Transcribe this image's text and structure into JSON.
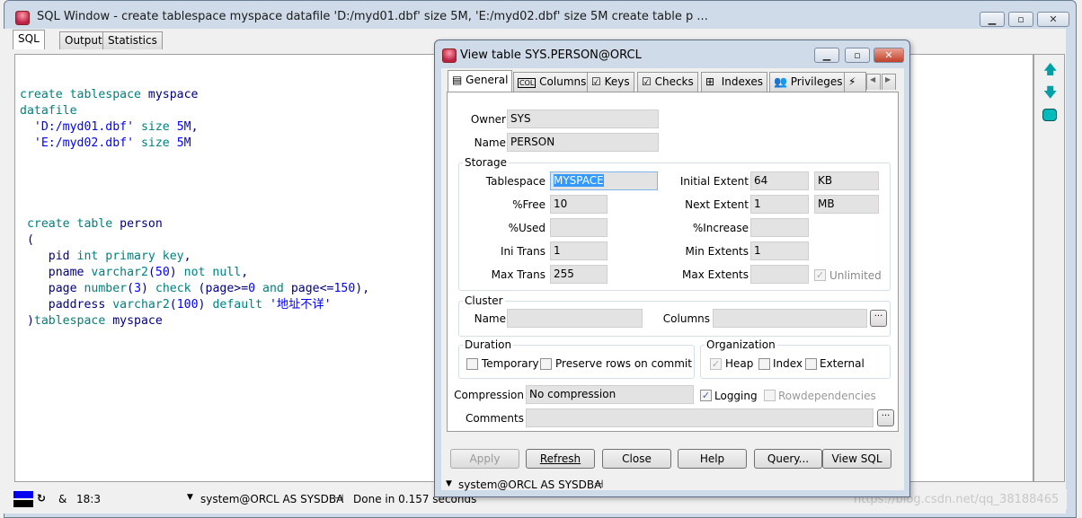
{
  "main_window": {
    "title": "SQL Window - create tablespace myspace datafile 'D:/myd01.dbf' size 5M, 'E:/myd02.dbf' size 5M create table p ...",
    "tabs": [
      {
        "label": "SQL",
        "active": true
      },
      {
        "label": "Output",
        "active": false
      },
      {
        "label": "Statistics",
        "active": false
      }
    ],
    "code_lines": [
      [],
      [],
      [
        [
          "kw",
          "create tablespace "
        ],
        [
          "id",
          "myspace"
        ]
      ],
      [
        [
          "kw",
          "datafile"
        ]
      ],
      [
        [
          "pl",
          "  "
        ],
        [
          "str",
          "'D:/myd01.dbf'"
        ],
        [
          "kw",
          " size "
        ],
        [
          "num",
          "5M"
        ],
        [
          "pl",
          ","
        ]
      ],
      [
        [
          "pl",
          "  "
        ],
        [
          "str",
          "'E:/myd02.dbf'"
        ],
        [
          "kw",
          " size "
        ],
        [
          "num",
          "5M"
        ]
      ],
      [],
      [],
      [],
      [],
      [
        [
          "pl",
          " "
        ],
        [
          "kw",
          "create table "
        ],
        [
          "id",
          "person"
        ]
      ],
      [
        [
          "pl",
          " ("
        ]
      ],
      [
        [
          "pl",
          "    "
        ],
        [
          "id",
          "pid"
        ],
        [
          "kw",
          " int primary key"
        ],
        [
          "pl",
          ","
        ]
      ],
      [
        [
          "pl",
          "    "
        ],
        [
          "id",
          "pname"
        ],
        [
          "kw",
          " varchar2"
        ],
        [
          "pl",
          "("
        ],
        [
          "num",
          "50"
        ],
        [
          "pl",
          ")"
        ],
        [
          "kw",
          " not null"
        ],
        [
          "pl",
          ","
        ]
      ],
      [
        [
          "pl",
          "    "
        ],
        [
          "id",
          "page"
        ],
        [
          "kw",
          " number"
        ],
        [
          "pl",
          "("
        ],
        [
          "num",
          "3"
        ],
        [
          "pl",
          ")"
        ],
        [
          "kw",
          " check "
        ],
        [
          "pl",
          "("
        ],
        [
          "id",
          "page"
        ],
        [
          "pl",
          ">="
        ],
        [
          "num",
          "0"
        ],
        [
          "kw",
          " and "
        ],
        [
          "id",
          "page"
        ],
        [
          "pl",
          "<="
        ],
        [
          "num",
          "150"
        ],
        [
          "pl",
          "),"
        ]
      ],
      [
        [
          "pl",
          "    "
        ],
        [
          "id",
          "paddress"
        ],
        [
          "kw",
          " varchar2"
        ],
        [
          "pl",
          "("
        ],
        [
          "num",
          "100"
        ],
        [
          "pl",
          ")"
        ],
        [
          "kw",
          " default "
        ],
        [
          "str",
          "'地址不详'"
        ]
      ],
      [
        [
          "pl",
          " )"
        ],
        [
          "kw",
          "tablespace "
        ],
        [
          "id",
          "myspace"
        ]
      ]
    ],
    "toolbar_icons": [
      "arrow-up-icon",
      "arrow-down-icon",
      "database-execute-icon"
    ],
    "status": {
      "cursor": "18:3",
      "connection": "system@ORCL AS SYSDBA",
      "message": "Done in 0.157 seconds",
      "ampersand": "&"
    }
  },
  "dialog": {
    "title": "View table SYS.PERSON@ORCL",
    "tabs": [
      {
        "label": "General",
        "icon": "form-icon"
      },
      {
        "label": "Columns",
        "icon": "columns-icon"
      },
      {
        "label": "Keys",
        "icon": "key-check-icon"
      },
      {
        "label": "Checks",
        "icon": "check-icon"
      },
      {
        "label": "Indexes",
        "icon": "index-icon"
      },
      {
        "label": "Privileges",
        "icon": "users-icon"
      },
      {
        "label": "",
        "icon": "trigger-icon"
      }
    ],
    "owner_label": "Owner",
    "owner": "SYS",
    "name_label": "Name",
    "name": "PERSON",
    "storage": {
      "title": "Storage",
      "tablespace_label": "Tablespace",
      "tablespace": "MYSPACE",
      "pctfree_label": "%Free",
      "pctfree": "10",
      "pctused_label": "%Used",
      "pctused": "",
      "initrans_label": "Ini Trans",
      "initrans": "1",
      "maxtrans_label": "Max Trans",
      "maxtrans": "255",
      "initial_label": "Initial Extent",
      "initial": "64",
      "initial_unit": "KB",
      "next_label": "Next Extent",
      "next": "1",
      "next_unit": "MB",
      "pctincrease_label": "%Increase",
      "pctincrease": "",
      "minext_label": "Min Extents",
      "minext": "1",
      "maxext_label": "Max Extents",
      "maxext": "",
      "unlimited_label": "Unlimited",
      "unlimited": true
    },
    "cluster": {
      "title": "Cluster",
      "name_label": "Name",
      "name": "",
      "columns_label": "Columns",
      "columns": ""
    },
    "duration": {
      "title": "Duration",
      "temporary": "Temporary",
      "preserve": "Preserve rows on commit"
    },
    "organization": {
      "title": "Organization",
      "heap": "Heap",
      "index": "Index",
      "external": "External",
      "selected": "Heap"
    },
    "compression_label": "Compression",
    "compression": "No compression",
    "logging_label": "Logging",
    "logging": true,
    "rowdep_label": "Rowdependencies",
    "rowdep": false,
    "comments_label": "Comments",
    "comments": "",
    "buttons": {
      "apply": "Apply",
      "refresh": "Refresh",
      "close": "Close",
      "help": "Help",
      "query": "Query...",
      "viewsql": "View SQL"
    },
    "status_connection": "system@ORCL AS SYSDBA"
  },
  "watermark": "https://blog.csdn.net/qq_38188465"
}
